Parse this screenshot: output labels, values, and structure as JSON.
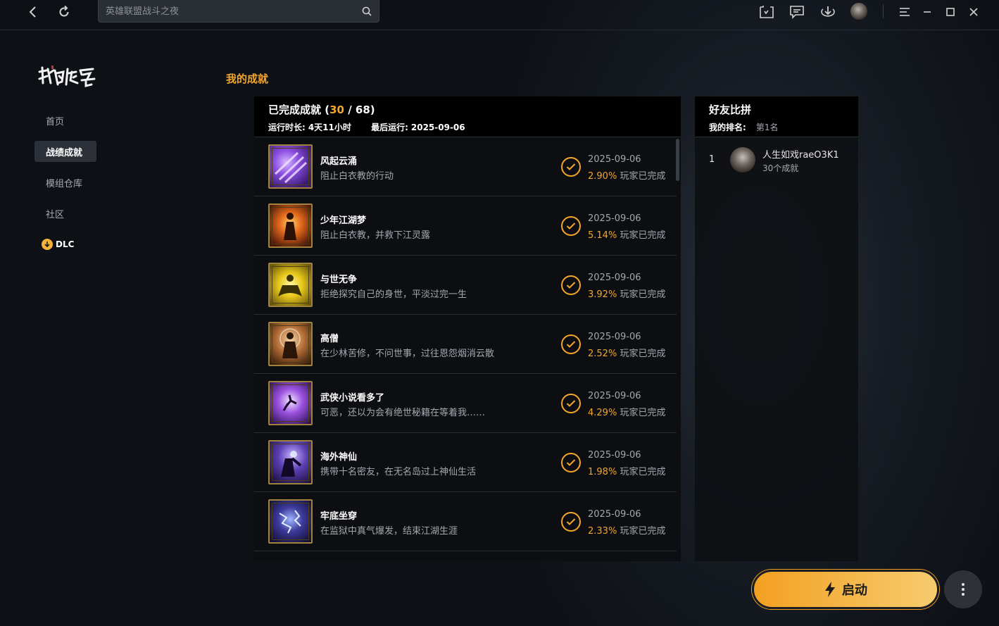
{
  "topbar": {
    "search_placeholder": "英雄联盟战斗之夜"
  },
  "sidebar": {
    "logo_text": "我的侠客",
    "items": [
      {
        "label": "首页",
        "active": false
      },
      {
        "label": "战绩成就",
        "active": true
      },
      {
        "label": "模组仓库",
        "active": false
      },
      {
        "label": "社区",
        "active": false
      },
      {
        "label": "DLC",
        "active": false
      }
    ]
  },
  "main": {
    "section_title": "我的成就"
  },
  "achievements": {
    "title": "已完成成就",
    "open_paren": "(",
    "completed": "30",
    "slash": " / ",
    "total": "68",
    "close_paren": ")",
    "runtime_label": "运行时长:",
    "runtime_value": "4天11小时",
    "last_run_label": "最后运行:",
    "last_run_value": "2025-09-06",
    "rate_suffix": "玩家已完成",
    "items": [
      {
        "name": "风起云涌",
        "desc": "阻止白衣教的行动",
        "date": "2025-09-06",
        "pct": "2.90%",
        "icon": "purple-slash-icon"
      },
      {
        "name": "少年江湖梦",
        "desc": "阻止白衣教，并救下江灵露",
        "date": "2025-09-06",
        "pct": "5.14%",
        "icon": "fire-figure-icon"
      },
      {
        "name": "与世无争",
        "desc": "拒绝探究自己的身世，平淡过完一生",
        "date": "2025-09-06",
        "pct": "3.92%",
        "icon": "meditating-figure-icon"
      },
      {
        "name": "高僧",
        "desc": "在少林苦修，不问世事，过往恩怨烟消云散",
        "date": "2025-09-06",
        "pct": "2.52%",
        "icon": "monk-icon"
      },
      {
        "name": "武侠小说看多了",
        "desc": "可恶，还以为会有绝世秘籍在等着我……",
        "date": "2025-09-06",
        "pct": "4.29%",
        "icon": "falling-figure-icon"
      },
      {
        "name": "海外神仙",
        "desc": "携带十名密友，在无名岛过上神仙生活",
        "date": "2025-09-06",
        "pct": "1.98%",
        "icon": "immortal-figure-icon"
      },
      {
        "name": "牢底坐穿",
        "desc": "在监狱中真气爆发，结束江湖生涯",
        "date": "2025-09-06",
        "pct": "2.33%",
        "icon": "lightning-prison-icon"
      }
    ]
  },
  "friends": {
    "title": "好友比拼",
    "my_rank_label": "我的排名:",
    "my_rank_value": "第1名",
    "list": [
      {
        "rank": "1",
        "name": "人生如戏raeO3K1",
        "count": "30个成就"
      }
    ]
  },
  "actions": {
    "launch_label": "启动"
  },
  "colors": {
    "accent": "#f4a62a",
    "launch_start": "#f3a021",
    "launch_end": "#f6cc6e"
  }
}
